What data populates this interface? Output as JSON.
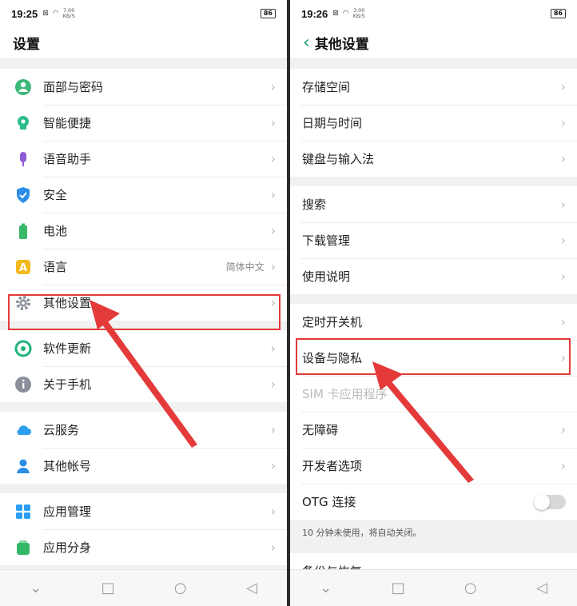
{
  "left": {
    "status": {
      "time": "19:25",
      "speed_value": "7.00",
      "speed_unit": "KB/S",
      "battery": "86"
    },
    "title": "设置",
    "groups": [
      [
        {
          "label": "面部与密码",
          "icon": "face-password-icon",
          "color": "#3cb878"
        },
        {
          "label": "智能便捷",
          "icon": "smart-assist-icon",
          "color": "#2ebc8a"
        },
        {
          "label": "语音助手",
          "icon": "voice-assistant-icon",
          "color": "#8f5bd6"
        },
        {
          "label": "安全",
          "icon": "security-shield-icon",
          "color": "#2b8ee6"
        },
        {
          "label": "电池",
          "icon": "battery-icon",
          "color": "#39b86a"
        },
        {
          "label": "语言",
          "value": "简体中文",
          "icon": "language-icon",
          "color": "#f2b81c"
        },
        {
          "label": "其他设置",
          "icon": "gear-icon",
          "color": "#8a8f99"
        }
      ],
      [
        {
          "label": "软件更新",
          "icon": "software-update-icon",
          "color": "#1fb37a"
        },
        {
          "label": "关于手机",
          "icon": "info-icon",
          "color": "#8a8f99"
        }
      ],
      [
        {
          "label": "云服务",
          "icon": "cloud-icon",
          "color": "#2b9ef0"
        },
        {
          "label": "其他帐号",
          "icon": "account-icon",
          "color": "#2b8ee6"
        }
      ],
      [
        {
          "label": "应用管理",
          "icon": "app-management-icon",
          "color": "#2b9ef0"
        },
        {
          "label": "应用分身",
          "icon": "app-clone-icon",
          "color": "#34b868"
        }
      ]
    ]
  },
  "right": {
    "status": {
      "time": "19:26",
      "speed_value": "3.00",
      "speed_unit": "KB/S",
      "battery": "86"
    },
    "title": "其他设置",
    "groups": [
      [
        {
          "label": "存储空间"
        },
        {
          "label": "日期与时间"
        },
        {
          "label": "键盘与输入法"
        }
      ],
      [
        {
          "label": "搜索"
        },
        {
          "label": "下载管理"
        },
        {
          "label": "使用说明"
        }
      ],
      [
        {
          "label": "定时开关机"
        },
        {
          "label": "设备与隐私"
        },
        {
          "label": "SIM 卡应用程序",
          "disabled": true
        },
        {
          "label": "无障碍"
        },
        {
          "label": "开发者选项"
        },
        {
          "label": "OTG 连接",
          "toggle": false
        }
      ]
    ],
    "note": "10 分钟未使用，将自动关闭。",
    "partial_row": "备份与恢复"
  },
  "accent_highlight": "#e43a3a",
  "accent_brand": "#1aa06e"
}
